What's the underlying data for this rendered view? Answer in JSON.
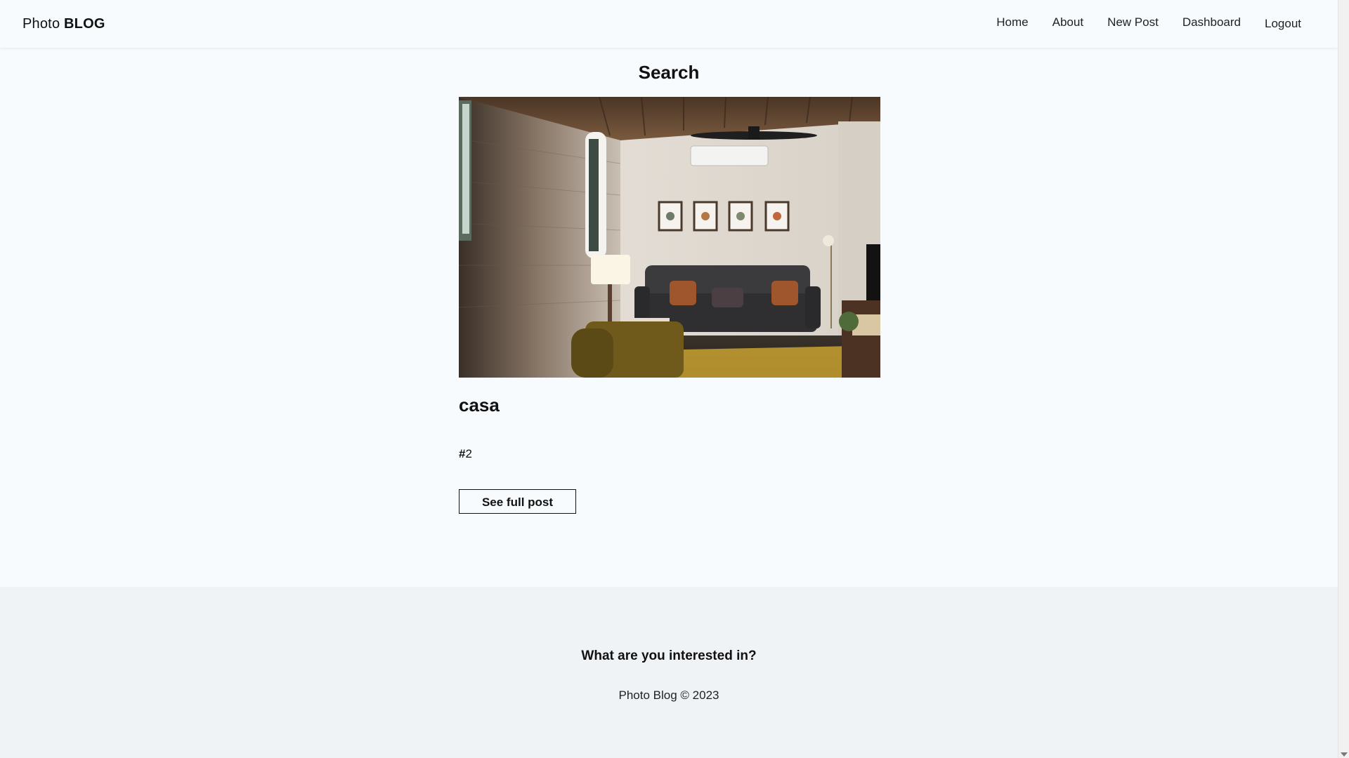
{
  "header": {
    "brand_light": "Photo ",
    "brand_bold": "BLOG",
    "nav": {
      "home": "Home",
      "about": "About",
      "new_post": "New Post",
      "dashboard": "Dashboard",
      "logout": "Logout"
    }
  },
  "main": {
    "page_title": "Search",
    "post": {
      "title": "casa",
      "tag_hash": "#",
      "tag_value": "2",
      "button_label": "See full post",
      "image_icon": "living-room-photo"
    }
  },
  "footer": {
    "question": "What are you interested in?",
    "copyright": "Photo Blog © 2023"
  },
  "colors": {
    "page_bg": "#f7fbfd",
    "footer_bg": "#eff3f6",
    "text": "#111111"
  }
}
